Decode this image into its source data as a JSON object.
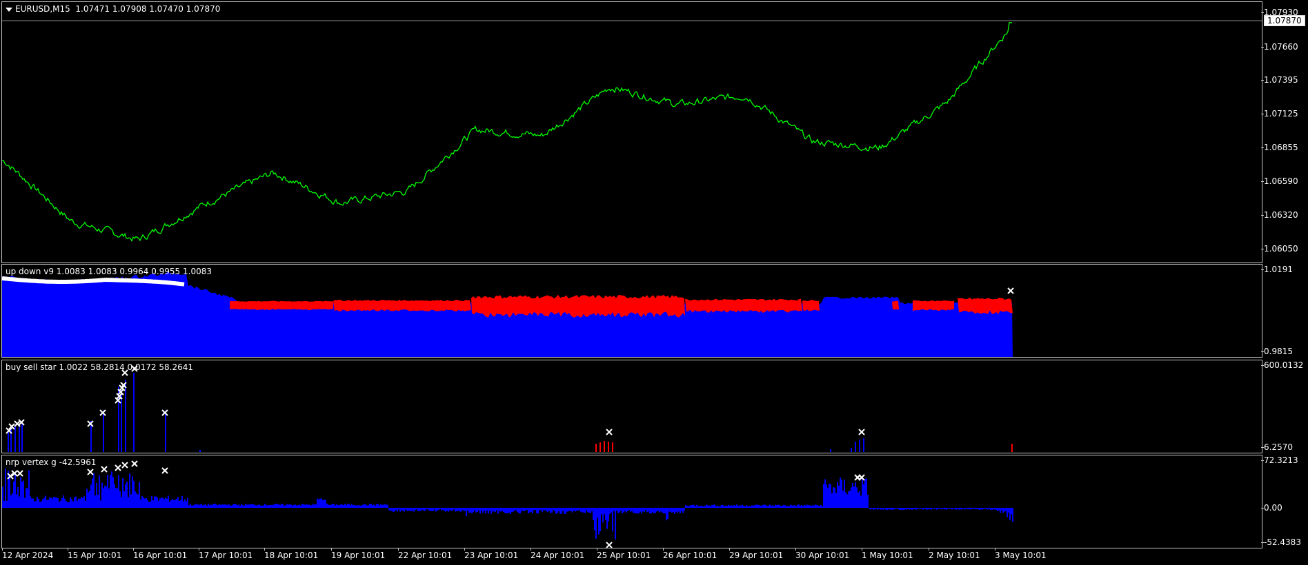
{
  "main_pane": {
    "label": "EURUSD,M15  1.07471 1.07908 1.07470 1.07870",
    "current_price": "1.07870",
    "y_ticks": [
      "1.07930",
      "1.07660",
      "1.07395",
      "1.07125",
      "1.06855",
      "1.06590",
      "1.06320",
      "1.06050"
    ],
    "line_color": "#00ff00"
  },
  "pane2": {
    "label": "up down v9 1.0083 1.0083 0.9964 0.9955 1.0083",
    "y_ticks": [
      "1.0191",
      "0.9815"
    ],
    "colors": {
      "fill": "#0000ff",
      "band": "#ff0000",
      "markers": "#ffffff"
    }
  },
  "pane3": {
    "label": "buy sell star 1.0022 58.2814 0.0172 58.2641",
    "y_ticks": [
      "600.0132",
      "6.2570"
    ]
  },
  "pane4": {
    "label": "nrp vertex g -42.5961",
    "y_ticks": [
      "72.3213",
      "0.00",
      "-52.4383"
    ]
  },
  "time_axis": [
    "12 Apr 2024",
    "15 Apr 10:01",
    "16 Apr 10:01",
    "17 Apr 10:01",
    "18 Apr 10:01",
    "19 Apr 10:01",
    "22 Apr 10:01",
    "23 Apr 10:01",
    "24 Apr 10:01",
    "25 Apr 10:01",
    "26 Apr 10:01",
    "29 Apr 10:01",
    "30 Apr 10:01",
    "1 May 10:01",
    "2 May 10:01",
    "3 May 10:01"
  ],
  "chart_data": {
    "type": "line",
    "title": "EURUSD,M15",
    "ylim": [
      1.0595,
      1.0797
    ],
    "series": [
      {
        "name": "EURUSD,M15",
        "x": [
          "12 Apr 2024",
          "15 Apr 10:01",
          "16 Apr 10:01",
          "17 Apr 10:01",
          "18 Apr 10:01",
          "19 Apr 10:01",
          "22 Apr 10:01",
          "23 Apr 10:01",
          "24 Apr 10:01",
          "25 Apr 10:01",
          "26 Apr 10:01",
          "29 Apr 10:01",
          "30 Apr 10:01",
          "1 May 10:01",
          "2 May 10:01",
          "3 May 10:01"
        ],
        "values": [
          1.0675,
          1.0625,
          1.061,
          1.064,
          1.0665,
          1.064,
          1.065,
          1.07,
          1.0695,
          1.0735,
          1.072,
          1.0728,
          1.069,
          1.0685,
          1.0722,
          1.0787
        ]
      }
    ]
  }
}
